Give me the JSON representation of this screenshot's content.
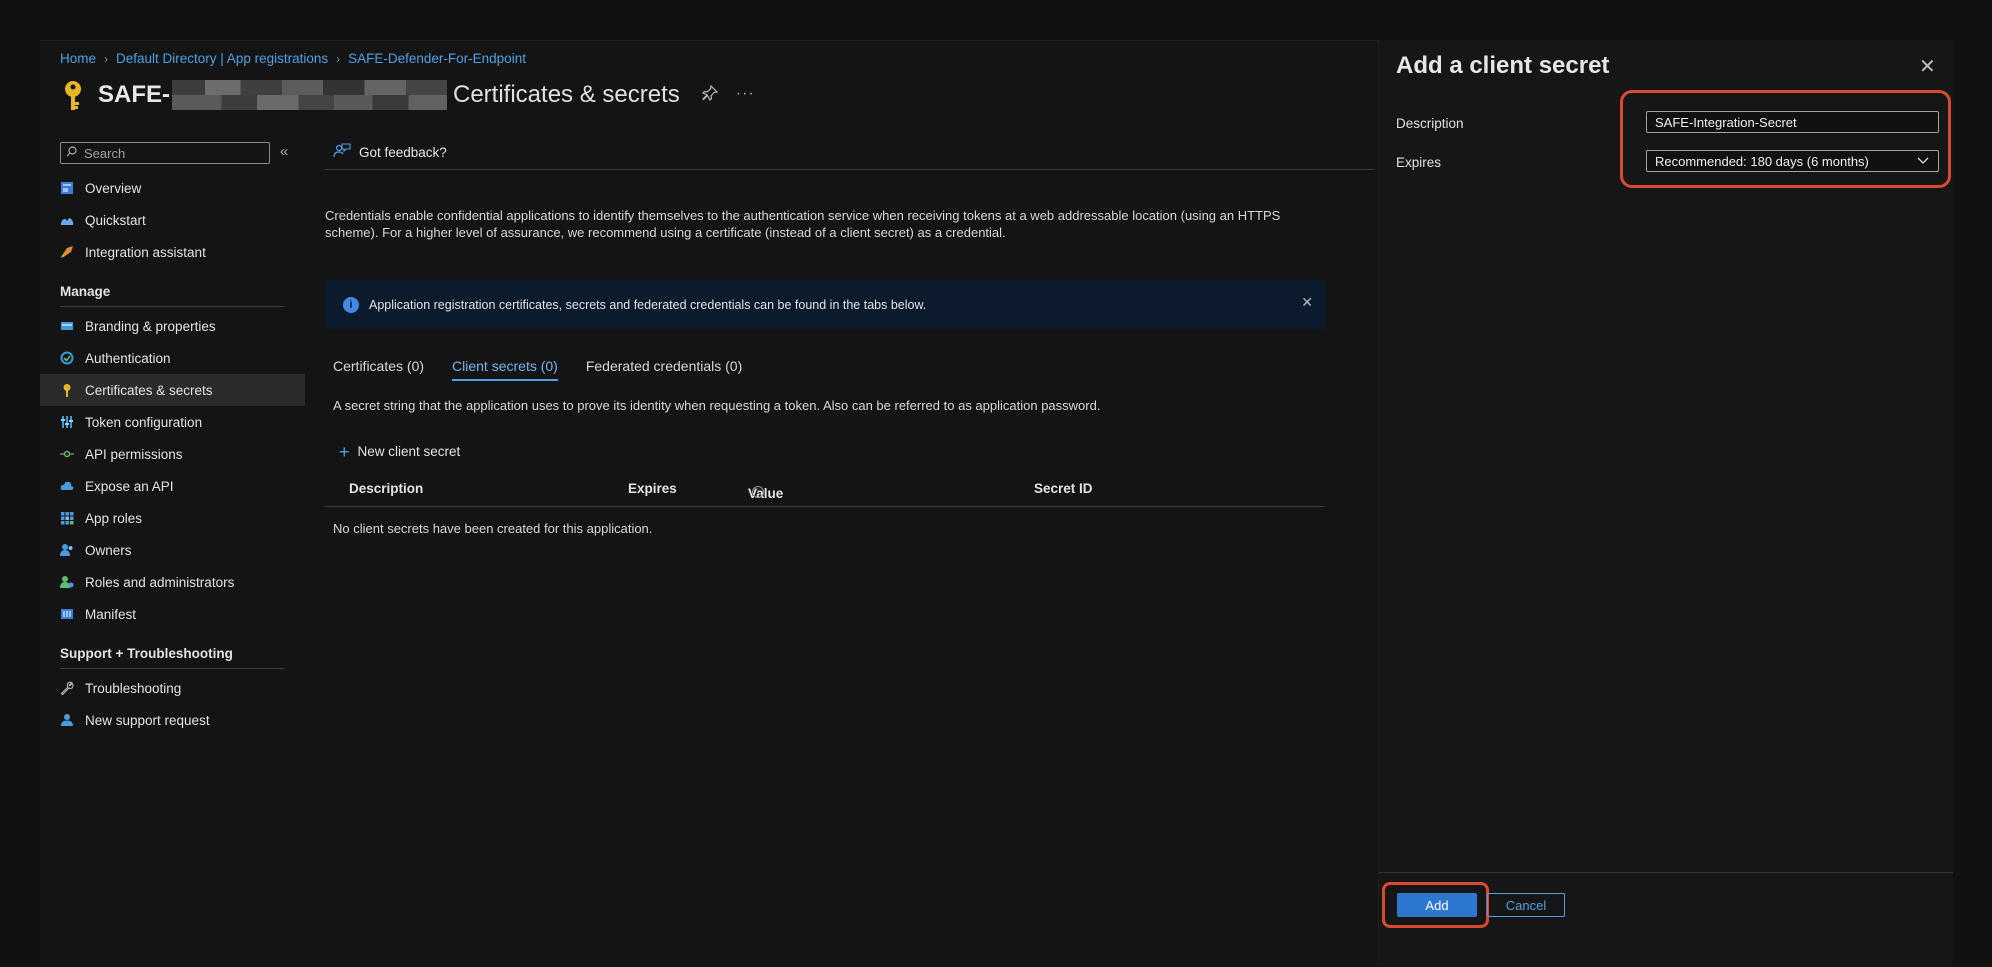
{
  "breadcrumb": [
    {
      "label": "Home"
    },
    {
      "label": "Default Directory | App registrations"
    },
    {
      "label": "SAFE-Defender-For-Endpoint"
    }
  ],
  "page": {
    "title_prefix": "SAFE-",
    "title_suffix": "Certificates & secrets",
    "pin_icon": "pin-icon",
    "more_icon": "ellipsis-icon"
  },
  "sidebar": {
    "search_placeholder": "Search",
    "top_items": [
      {
        "label": "Overview",
        "icon": "overview-icon"
      },
      {
        "label": "Quickstart",
        "icon": "quickstart-icon"
      },
      {
        "label": "Integration assistant",
        "icon": "rocket-icon"
      }
    ],
    "manage_heading": "Manage",
    "manage_items": [
      {
        "label": "Branding & properties",
        "icon": "branding-icon"
      },
      {
        "label": "Authentication",
        "icon": "authentication-icon"
      },
      {
        "label": "Certificates & secrets",
        "icon": "key-icon",
        "active": true
      },
      {
        "label": "Token configuration",
        "icon": "token-icon"
      },
      {
        "label": "API permissions",
        "icon": "api-permissions-icon"
      },
      {
        "label": "Expose an API",
        "icon": "cloud-icon"
      },
      {
        "label": "App roles",
        "icon": "app-roles-icon"
      },
      {
        "label": "Owners",
        "icon": "owners-icon"
      },
      {
        "label": "Roles and administrators",
        "icon": "roles-icon"
      },
      {
        "label": "Manifest",
        "icon": "manifest-icon"
      }
    ],
    "support_heading": "Support + Troubleshooting",
    "support_items": [
      {
        "label": "Troubleshooting",
        "icon": "wrench-icon"
      },
      {
        "label": "New support request",
        "icon": "support-person-icon"
      }
    ]
  },
  "main": {
    "feedback_label": "Got feedback?",
    "description": "Credentials enable confidential applications to identify themselves to the authentication service when receiving tokens at a web addressable location (using an HTTPS scheme). For a higher level of assurance, we recommend using a certificate (instead of a client secret) as a credential.",
    "info_banner": "Application registration certificates, secrets and federated credentials can be found in the tabs below.",
    "tabs": [
      {
        "label": "Certificates (0)"
      },
      {
        "label": "Client secrets (0)",
        "active": true
      },
      {
        "label": "Federated credentials (0)"
      }
    ],
    "secret_description": "A secret string that the application uses to prove its identity when requesting a token. Also can be referred to as application password.",
    "new_secret_label": "New client secret",
    "table_headers": [
      "Description",
      "Expires",
      "Value",
      "Secret ID"
    ],
    "empty_message": "No client secrets have been created for this application."
  },
  "panel": {
    "title": "Add a client secret",
    "description_label": "Description",
    "description_value": "SAFE-Integration-Secret",
    "expires_label": "Expires",
    "expires_value": "Recommended: 180 days (6 months)",
    "add_label": "Add",
    "cancel_label": "Cancel"
  },
  "colors": {
    "accent": "#4ea1e6",
    "highlight": "#d94a33",
    "primary_button": "#2d77d0"
  }
}
